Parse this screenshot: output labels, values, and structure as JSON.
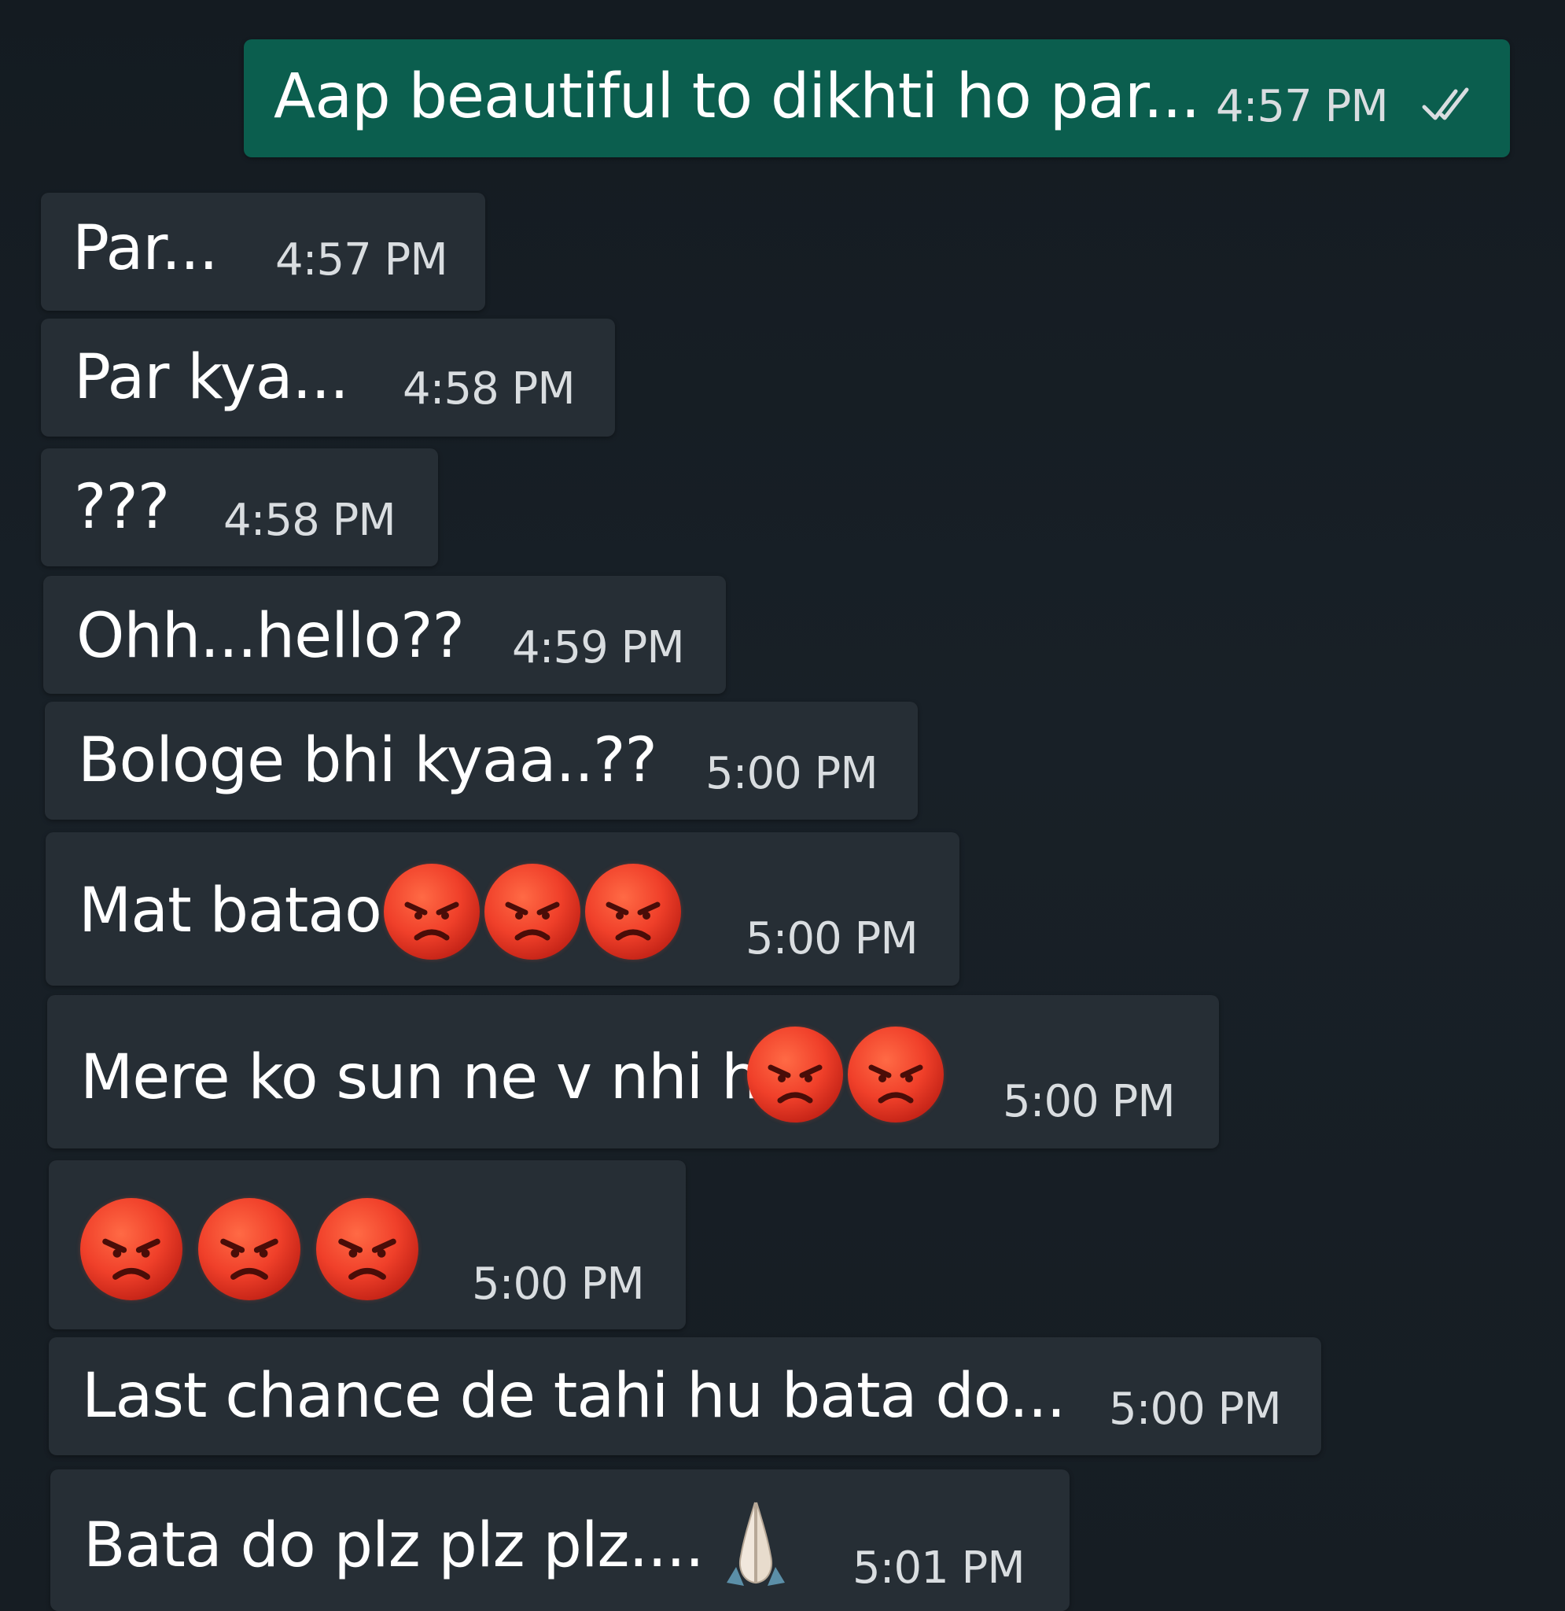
{
  "messages": [
    {
      "id": "m1",
      "direction": "outgoing",
      "text": "Aap beautiful to dikhti ho par...",
      "time": "4:57 PM",
      "status": "read-double-check"
    },
    {
      "id": "m2",
      "direction": "incoming",
      "text": "Par...",
      "time": "4:57 PM"
    },
    {
      "id": "m3",
      "direction": "incoming",
      "text": "Par kya...",
      "time": "4:58 PM"
    },
    {
      "id": "m4",
      "direction": "incoming",
      "text": "???",
      "time": "4:58 PM"
    },
    {
      "id": "m5",
      "direction": "incoming",
      "text": "Ohh...hello??",
      "time": "4:59 PM"
    },
    {
      "id": "m6",
      "direction": "incoming",
      "text": "Bologe bhi kyaa..??",
      "time": "5:00 PM"
    },
    {
      "id": "m7",
      "direction": "incoming",
      "text": "Mat batao",
      "time": "5:00 PM",
      "emojis": [
        "angry-face",
        "angry-face",
        "angry-face"
      ]
    },
    {
      "id": "m8",
      "direction": "incoming",
      "text": "Mere ko sun ne v nhi h",
      "time": "5:00 PM",
      "emojis": [
        "angry-face",
        "angry-face"
      ]
    },
    {
      "id": "m9",
      "direction": "incoming",
      "text": "",
      "time": "5:00 PM",
      "emojis": [
        "angry-face",
        "angry-face",
        "angry-face"
      ]
    },
    {
      "id": "m10",
      "direction": "incoming",
      "text": "Last chance de tahi hu bata do...",
      "time": "5:00 PM"
    },
    {
      "id": "m11",
      "direction": "incoming",
      "text": "Bata do plz plz plz....",
      "time": "5:01 PM",
      "emojis": [
        "folded-hands"
      ]
    }
  ],
  "colors": {
    "background": "#161d23",
    "incoming_bubble": "#262e35",
    "outgoing_bubble": "#0b5e4e",
    "text": "#ffffff",
    "timestamp": "#d9dde0",
    "read_tick": "#d9dde0"
  }
}
